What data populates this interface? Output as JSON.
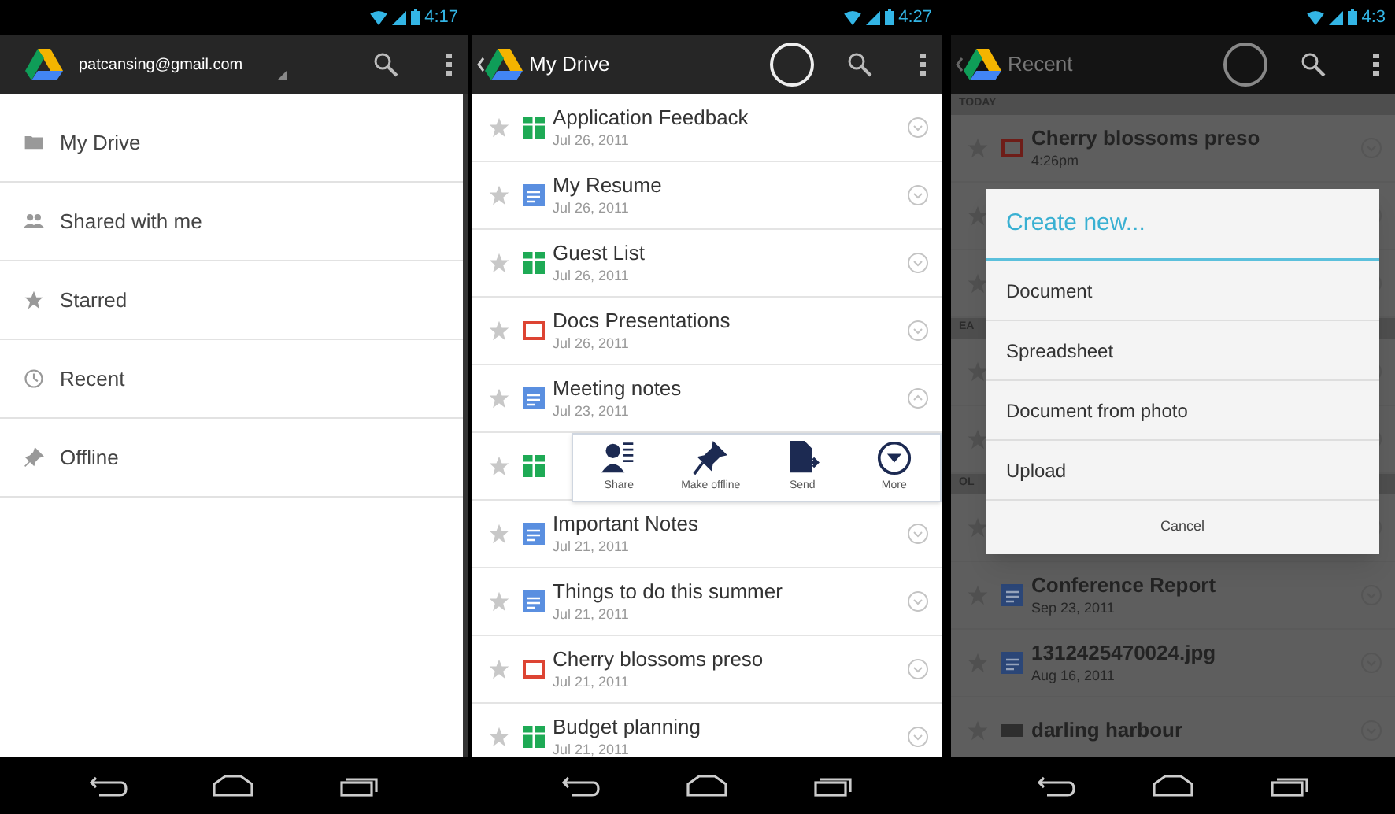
{
  "screens": [
    {
      "kind": "drawer",
      "status_time": "4:17",
      "app_bar": {
        "kind": "account",
        "title": "patcansing@gmail.com",
        "loading": false
      },
      "menu": [
        {
          "kind": "folder",
          "label": "My Drive"
        },
        {
          "kind": "people",
          "label": "Shared with me"
        },
        {
          "kind": "star",
          "label": "Starred"
        },
        {
          "kind": "clock",
          "label": "Recent"
        },
        {
          "kind": "pin",
          "label": "Offline"
        }
      ]
    },
    {
      "kind": "list",
      "status_time": "4:27",
      "app_bar": {
        "kind": "title",
        "title": "My Drive",
        "loading": true
      },
      "dimmed": false,
      "files": [
        {
          "kind": "spreadsheet",
          "name": "Application Feedback",
          "date": "Jul 26, 2011"
        },
        {
          "kind": "document",
          "name": "My Resume",
          "date": "Jul 26, 2011"
        },
        {
          "kind": "spreadsheet",
          "name": "Guest List",
          "date": "Jul 26, 2011"
        },
        {
          "kind": "presentation",
          "name": "Docs Presentations",
          "date": "Jul 26, 2011"
        },
        {
          "kind": "document",
          "name": "Meeting notes",
          "date": "Jul 23, 2011",
          "expanded": true
        },
        {
          "kind": "spreadsheet",
          "actions": [
            {
              "kind": "share",
              "label": "Share"
            },
            {
              "kind": "pin",
              "label": "Make offline"
            },
            {
              "kind": "send",
              "label": "Send"
            },
            {
              "kind": "more",
              "label": "More"
            }
          ]
        },
        {
          "kind": "document",
          "name": "Important Notes",
          "date": "Jul 21, 2011"
        },
        {
          "kind": "document",
          "name": "Things to do this summer",
          "date": "Jul 21, 2011"
        },
        {
          "kind": "presentation",
          "name": "Cherry blossoms preso",
          "date": "Jul 21, 2011"
        },
        {
          "kind": "spreadsheet",
          "name": "Budget planning",
          "date": "Jul 21, 2011"
        }
      ]
    },
    {
      "kind": "list",
      "status_time": "4:3",
      "app_bar": {
        "kind": "title",
        "title": "Recent",
        "loading": true
      },
      "dimmed": true,
      "files": [
        {
          "kind": "header",
          "name": "TODAY"
        },
        {
          "kind": "presentation",
          "name": "Cherry blossoms preso",
          "date": "4:26pm"
        },
        {
          "kind": "blank"
        },
        {
          "kind": "blank"
        },
        {
          "kind": "header",
          "name": "EA"
        },
        {
          "kind": "blank"
        },
        {
          "kind": "blank"
        },
        {
          "kind": "header",
          "name": "OL"
        },
        {
          "kind": "blank"
        },
        {
          "kind": "document",
          "name": "Conference Report",
          "date": "Sep 23, 2011"
        },
        {
          "kind": "document",
          "name": "1312425470024.jpg",
          "date": "Aug 16, 2011"
        },
        {
          "kind": "image",
          "name": "darling harbour"
        }
      ],
      "dialog": {
        "title": "Create new...",
        "options": [
          "Document",
          "Spreadsheet",
          "Document from photo",
          "Upload"
        ],
        "cancel": "Cancel"
      }
    }
  ]
}
